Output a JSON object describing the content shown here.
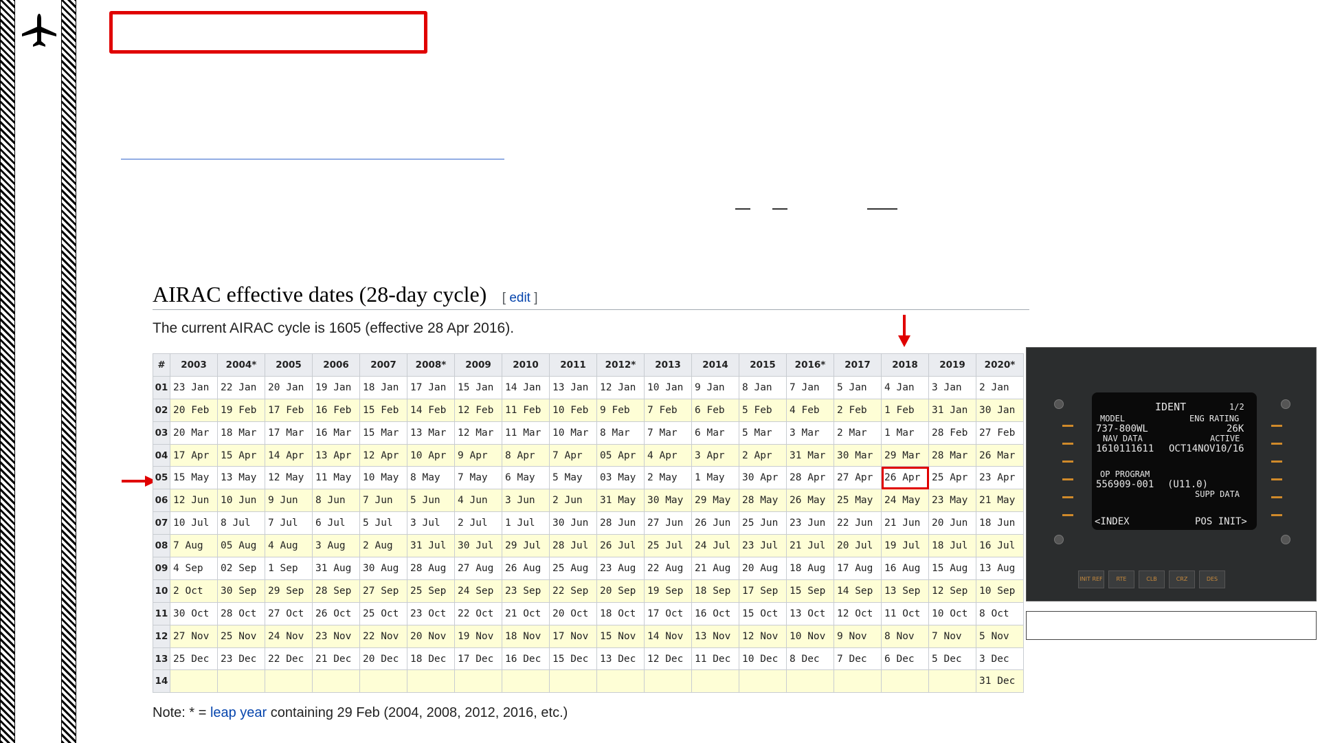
{
  "section": {
    "heading": "AIRAC effective dates (28-day cycle)",
    "edit_open": "[ ",
    "edit_label": "edit",
    "edit_close": " ]",
    "current_cycle_text": "The current AIRAC cycle is 1605 (effective 28 Apr 2016)."
  },
  "table": {
    "corner_header": "#",
    "years": [
      "2003",
      "2004*",
      "2005",
      "2006",
      "2007",
      "2008*",
      "2009",
      "2010",
      "2011",
      "2012*",
      "2013",
      "2014",
      "2015",
      "2016*",
      "2017",
      "2018",
      "2019",
      "2020*"
    ],
    "rows": [
      {
        "num": "01",
        "cells": [
          "23 Jan",
          "22 Jan",
          "20 Jan",
          "19 Jan",
          "18 Jan",
          "17 Jan",
          "15 Jan",
          "14 Jan",
          "13 Jan",
          "12 Jan",
          "10 Jan",
          "9 Jan",
          "8 Jan",
          "7 Jan",
          "5 Jan",
          "4 Jan",
          "3 Jan",
          "2 Jan"
        ]
      },
      {
        "num": "02",
        "cells": [
          "20 Feb",
          "19 Feb",
          "17 Feb",
          "16 Feb",
          "15 Feb",
          "14 Feb",
          "12 Feb",
          "11 Feb",
          "10 Feb",
          "9 Feb",
          "7 Feb",
          "6 Feb",
          "5 Feb",
          "4 Feb",
          "2 Feb",
          "1 Feb",
          "31 Jan",
          "30 Jan"
        ]
      },
      {
        "num": "03",
        "cells": [
          "20 Mar",
          "18 Mar",
          "17 Mar",
          "16 Mar",
          "15 Mar",
          "13 Mar",
          "12 Mar",
          "11 Mar",
          "10 Mar",
          "8 Mar",
          "7 Mar",
          "6 Mar",
          "5 Mar",
          "3 Mar",
          "2 Mar",
          "1 Mar",
          "28 Feb",
          "27 Feb"
        ]
      },
      {
        "num": "04",
        "cells": [
          "17 Apr",
          "15 Apr",
          "14 Apr",
          "13 Apr",
          "12 Apr",
          "10 Apr",
          "9 Apr",
          "8 Apr",
          "7 Apr",
          "05 Apr",
          "4 Apr",
          "3 Apr",
          "2 Apr",
          "31 Mar",
          "30 Mar",
          "29 Mar",
          "28 Mar",
          "26 Mar"
        ]
      },
      {
        "num": "05",
        "cells": [
          "15 May",
          "13 May",
          "12 May",
          "11 May",
          "10 May",
          "8 May",
          "7 May",
          "6 May",
          "5 May",
          "03 May",
          "2 May",
          "1 May",
          "30 Apr",
          "28 Apr",
          "27 Apr",
          "26 Apr",
          "25 Apr",
          "23 Apr"
        ]
      },
      {
        "num": "06",
        "cells": [
          "12 Jun",
          "10 Jun",
          "9 Jun",
          "8 Jun",
          "7 Jun",
          "5 Jun",
          "4 Jun",
          "3 Jun",
          "2 Jun",
          "31 May",
          "30 May",
          "29 May",
          "28 May",
          "26 May",
          "25 May",
          "24 May",
          "23 May",
          "21 May"
        ]
      },
      {
        "num": "07",
        "cells": [
          "10 Jul",
          "8 Jul",
          "7 Jul",
          "6 Jul",
          "5 Jul",
          "3 Jul",
          "2 Jul",
          "1 Jul",
          "30 Jun",
          "28 Jun",
          "27 Jun",
          "26 Jun",
          "25 Jun",
          "23 Jun",
          "22 Jun",
          "21 Jun",
          "20 Jun",
          "18 Jun"
        ]
      },
      {
        "num": "08",
        "cells": [
          "7 Aug",
          "05 Aug",
          "4 Aug",
          "3 Aug",
          "2 Aug",
          "31 Jul",
          "30 Jul",
          "29 Jul",
          "28 Jul",
          "26 Jul",
          "25 Jul",
          "24 Jul",
          "23 Jul",
          "21 Jul",
          "20 Jul",
          "19 Jul",
          "18 Jul",
          "16 Jul"
        ]
      },
      {
        "num": "09",
        "cells": [
          "4 Sep",
          "02 Sep",
          "1 Sep",
          "31 Aug",
          "30 Aug",
          "28 Aug",
          "27 Aug",
          "26 Aug",
          "25 Aug",
          "23 Aug",
          "22 Aug",
          "21 Aug",
          "20 Aug",
          "18 Aug",
          "17 Aug",
          "16 Aug",
          "15 Aug",
          "13 Aug"
        ]
      },
      {
        "num": "10",
        "cells": [
          "2 Oct",
          "30 Sep",
          "29 Sep",
          "28 Sep",
          "27 Sep",
          "25 Sep",
          "24 Sep",
          "23 Sep",
          "22 Sep",
          "20 Sep",
          "19 Sep",
          "18 Sep",
          "17 Sep",
          "15 Sep",
          "14 Sep",
          "13 Sep",
          "12 Sep",
          "10 Sep"
        ]
      },
      {
        "num": "11",
        "cells": [
          "30 Oct",
          "28 Oct",
          "27 Oct",
          "26 Oct",
          "25 Oct",
          "23 Oct",
          "22 Oct",
          "21 Oct",
          "20 Oct",
          "18 Oct",
          "17 Oct",
          "16 Oct",
          "15 Oct",
          "13 Oct",
          "12 Oct",
          "11 Oct",
          "10 Oct",
          "8 Oct"
        ]
      },
      {
        "num": "12",
        "cells": [
          "27 Nov",
          "25 Nov",
          "24 Nov",
          "23 Nov",
          "22 Nov",
          "20 Nov",
          "19 Nov",
          "18 Nov",
          "17 Nov",
          "15 Nov",
          "14 Nov",
          "13 Nov",
          "12 Nov",
          "10 Nov",
          "9 Nov",
          "8 Nov",
          "7 Nov",
          "5 Nov"
        ]
      },
      {
        "num": "13",
        "cells": [
          "25 Dec",
          "23 Dec",
          "22 Dec",
          "21 Dec",
          "20 Dec",
          "18 Dec",
          "17 Dec",
          "16 Dec",
          "15 Dec",
          "13 Dec",
          "12 Dec",
          "11 Dec",
          "10 Dec",
          "8 Dec",
          "7 Dec",
          "6 Dec",
          "5 Dec",
          "3 Dec"
        ]
      },
      {
        "num": "14",
        "cells": [
          "",
          "",
          "",
          "",
          "",
          "",
          "",
          "",
          "",
          "",
          "",
          "",
          "",
          "",
          "",
          "",
          "",
          "31 Dec"
        ]
      }
    ],
    "highlighted_cell": {
      "row": "05",
      "year": "2018"
    }
  },
  "note": {
    "prefix": "Note: * = ",
    "link_label": "leap year",
    "suffix": " containing 29 Feb (2004, 2008, 2012, 2016, etc.)"
  },
  "fmc": {
    "title": "IDENT",
    "page": "1/2",
    "model_label": "MODEL",
    "eng_rating_label": "ENG RATING",
    "model_value": "737-800WL",
    "eng_rating_value": "26K",
    "nav_data_label": "NAV DATA",
    "active_label": "ACTIVE",
    "nav_data_value": "1610111611",
    "active_value": "OCT14NOV10/16",
    "op_program_label": "OP PROGRAM",
    "op_program_value": "556909-001",
    "op_program_version": "(U11.0)",
    "supp_data_label": "SUPP DATA",
    "index_label": "<INDEX",
    "pos_init_label": "POS INIT>",
    "keys": [
      "INIT REF",
      "RTE",
      "CLB",
      "CRZ",
      "DES"
    ]
  },
  "colors": {
    "highlight_red": "#e00000",
    "link_blue": "#0645ad",
    "row_tint": "#fefed6",
    "fmc_text": "#e8e8e8",
    "fmc_key_text": "#c88a3c"
  },
  "icons": [
    "airplane-icon",
    "down-arrow-icon",
    "right-arrow-icon"
  ]
}
